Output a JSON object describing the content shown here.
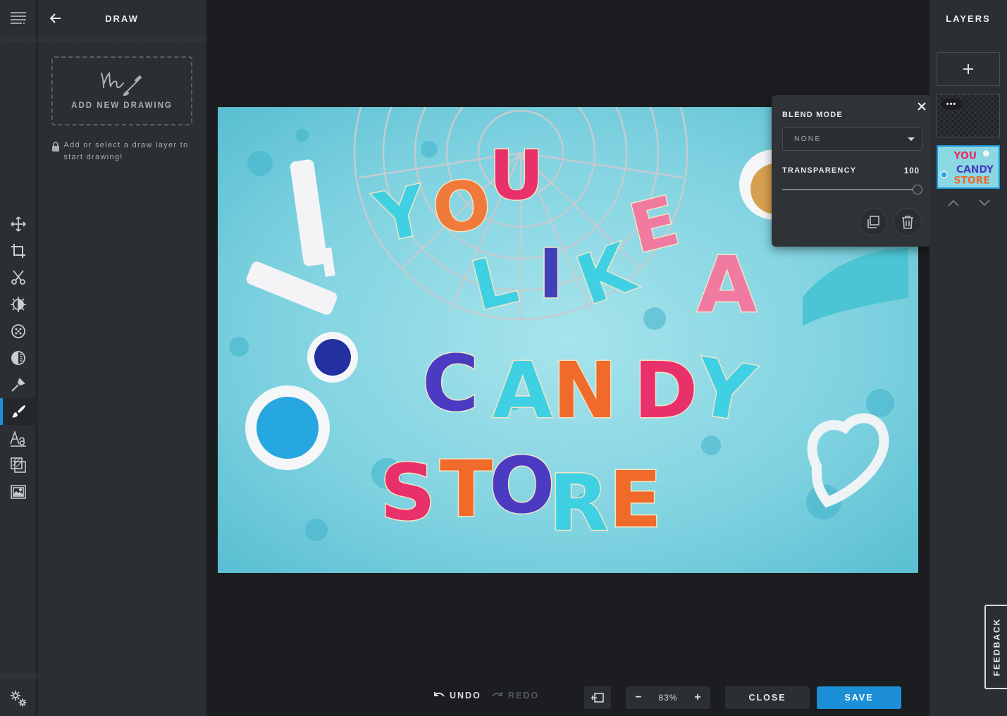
{
  "panel": {
    "title": "DRAW",
    "add_drawing_label": "ADD NEW DRAWING",
    "hint": "Add or select a draw layer to start drawing!"
  },
  "tools": [
    {
      "name": "move-icon"
    },
    {
      "name": "crop-icon"
    },
    {
      "name": "cut-icon"
    },
    {
      "name": "adjust-icon"
    },
    {
      "name": "filter-icon"
    },
    {
      "name": "vignette-icon"
    },
    {
      "name": "pen-icon"
    },
    {
      "name": "brush-icon",
      "active": true
    },
    {
      "name": "text-icon"
    },
    {
      "name": "overlay-icon"
    },
    {
      "name": "image-icon"
    }
  ],
  "popup": {
    "blend_mode_label": "BLEND MODE",
    "blend_mode_value": "NONE",
    "transparency_label": "TRANSPARENCY",
    "transparency_value": "100",
    "transparency_fraction": 1.0
  },
  "layers": {
    "title": "LAYERS",
    "blank_layer_menu": "•••"
  },
  "feedback_label": "FEEDBACK",
  "bottom": {
    "undo": "UNDO",
    "redo": "REDO",
    "zoom_minus": "−",
    "zoom_value": "83%",
    "zoom_plus": "+",
    "close": "CLOSE",
    "save": "SAVE"
  },
  "colors": {
    "accent": "#1c93d8",
    "save_button": "#1c8fd6",
    "panel_bg": "#2b2e32",
    "canvas_bg": "#1b1d20"
  }
}
